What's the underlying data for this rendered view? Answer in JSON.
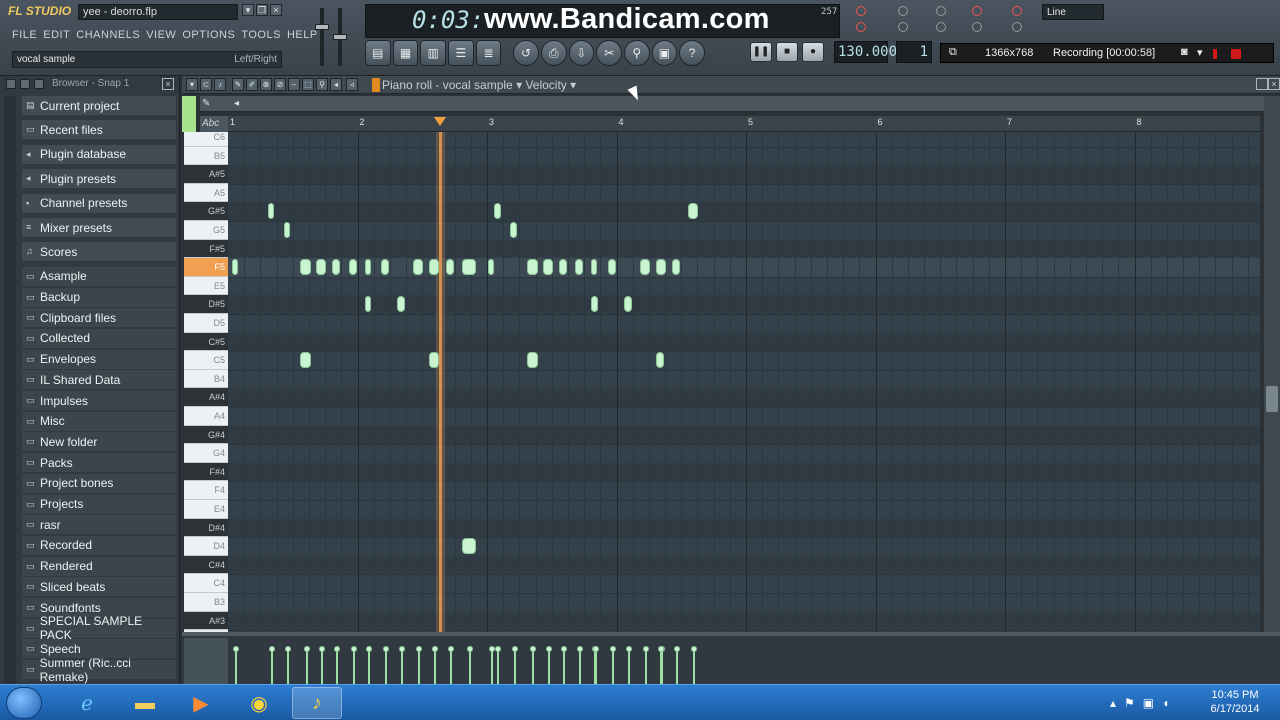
{
  "app": {
    "logo": "FL STUDIO",
    "file_title": "yee - deorro.flp",
    "menus": [
      "FILE",
      "EDIT",
      "CHANNELS",
      "VIEW",
      "OPTIONS",
      "TOOLS",
      "HELP"
    ],
    "hint_left": "vocal sample",
    "hint_right": "Left/Right",
    "time": "0:03:",
    "watermark": "www.Bandicam.com",
    "small_readout": "257",
    "bpm": "130.000",
    "pattern": "1",
    "snap": "Line"
  },
  "recording": {
    "resolution": "1366x768",
    "status": "Recording [00:00:58]"
  },
  "browser": {
    "title": "Browser - Snap 1",
    "items": [
      {
        "label": "Current project",
        "icon": "file-icon"
      },
      {
        "label": "Recent files",
        "icon": "folder-icon"
      },
      {
        "label": "Plugin database",
        "icon": "plug-icon"
      },
      {
        "label": "Plugin presets",
        "icon": "plug-icon"
      },
      {
        "label": "Channel presets",
        "icon": "channel-icon"
      },
      {
        "label": "Mixer presets",
        "icon": "mixer-icon"
      },
      {
        "label": "Scores",
        "icon": "note-icon"
      },
      {
        "label": "Asample",
        "icon": "folder-icon"
      },
      {
        "label": "Backup",
        "icon": "folder-icon"
      },
      {
        "label": "Clipboard files",
        "icon": "folder-icon"
      },
      {
        "label": "Collected",
        "icon": "folder-icon"
      },
      {
        "label": "Envelopes",
        "icon": "folder-icon"
      },
      {
        "label": "IL Shared Data",
        "icon": "folder-icon"
      },
      {
        "label": "Impulses",
        "icon": "folder-icon"
      },
      {
        "label": "Misc",
        "icon": "folder-icon"
      },
      {
        "label": "New folder",
        "icon": "folder-icon"
      },
      {
        "label": "Packs",
        "icon": "folder-icon"
      },
      {
        "label": "Project bones",
        "icon": "folder-icon"
      },
      {
        "label": "Projects",
        "icon": "folder-icon"
      },
      {
        "label": "rasr",
        "icon": "folder-icon"
      },
      {
        "label": "Recorded",
        "icon": "folder-icon"
      },
      {
        "label": "Rendered",
        "icon": "folder-icon"
      },
      {
        "label": "Sliced beats",
        "icon": "folder-icon"
      },
      {
        "label": "Soundfonts",
        "icon": "folder-icon"
      },
      {
        "label": "SPECIAL SAMPLE PACK",
        "icon": "folder-icon"
      },
      {
        "label": "Speech",
        "icon": "folder-icon"
      },
      {
        "label": "Summer (Ric..cci Remake)",
        "icon": "folder-icon"
      }
    ]
  },
  "piano_roll": {
    "title": "Piano roll - vocal sample",
    "target": "Velocity",
    "abc_label": "Abc",
    "ruler_bars": [
      "1",
      "2",
      "3",
      "4",
      "5",
      "6",
      "7",
      "8"
    ],
    "playhead_beat": 7.4,
    "active_key": "F5",
    "keys": [
      "C6",
      "B5",
      "A#5",
      "A5",
      "G#5",
      "G5",
      "F#5",
      "F5",
      "E5",
      "D#5",
      "D5",
      "C#5",
      "C5",
      "B4",
      "A#4",
      "A4",
      "G#4",
      "G4",
      "F#4",
      "F4",
      "E4",
      "D#4",
      "D4",
      "C#4",
      "C4",
      "B3",
      "A#3"
    ],
    "notes": [
      {
        "key": "F5",
        "start": 1.0,
        "len": 0.15
      },
      {
        "key": "G#5",
        "start": 2.1,
        "len": 0.2
      },
      {
        "key": "G5",
        "start": 2.6,
        "len": 0.2
      },
      {
        "key": "F5",
        "start": 3.1,
        "len": 0.35
      },
      {
        "key": "C5",
        "start": 3.1,
        "len": 0.35
      },
      {
        "key": "F5",
        "start": 3.6,
        "len": 0.3
      },
      {
        "key": "F5",
        "start": 4.1,
        "len": 0.25
      },
      {
        "key": "F5",
        "start": 4.6,
        "len": 0.25
      },
      {
        "key": "F5",
        "start": 5.1,
        "len": 0.15
      },
      {
        "key": "D#5",
        "start": 5.1,
        "len": 0.2
      },
      {
        "key": "F5",
        "start": 5.6,
        "len": 0.25
      },
      {
        "key": "D#5",
        "start": 6.1,
        "len": 0.25
      },
      {
        "key": "F5",
        "start": 6.6,
        "len": 0.3
      },
      {
        "key": "F5",
        "start": 7.1,
        "len": 0.3
      },
      {
        "key": "C5",
        "start": 7.1,
        "len": 0.3
      },
      {
        "key": "F5",
        "start": 7.6,
        "len": 0.25
      },
      {
        "key": "F5",
        "start": 8.1,
        "len": 0.45
      },
      {
        "key": "D4",
        "start": 8.1,
        "len": 0.45
      },
      {
        "key": "F5",
        "start": 8.9,
        "len": 0.15
      },
      {
        "key": "G#5",
        "start": 9.1,
        "len": 0.2
      },
      {
        "key": "G5",
        "start": 9.6,
        "len": 0.2
      },
      {
        "key": "F5",
        "start": 10.1,
        "len": 0.35
      },
      {
        "key": "C5",
        "start": 10.1,
        "len": 0.35
      },
      {
        "key": "F5",
        "start": 10.6,
        "len": 0.3
      },
      {
        "key": "F5",
        "start": 11.1,
        "len": 0.25
      },
      {
        "key": "F5",
        "start": 11.6,
        "len": 0.25
      },
      {
        "key": "F5",
        "start": 12.1,
        "len": 0.15
      },
      {
        "key": "D#5",
        "start": 12.1,
        "len": 0.2
      },
      {
        "key": "F5",
        "start": 12.6,
        "len": 0.25
      },
      {
        "key": "D#5",
        "start": 13.1,
        "len": 0.25
      },
      {
        "key": "F5",
        "start": 13.6,
        "len": 0.3
      },
      {
        "key": "F5",
        "start": 14.1,
        "len": 0.3
      },
      {
        "key": "C5",
        "start": 14.1,
        "len": 0.25
      },
      {
        "key": "F5",
        "start": 14.6,
        "len": 0.25
      },
      {
        "key": "G#5",
        "start": 15.1,
        "len": 0.3
      }
    ]
  },
  "taskbar": {
    "time": "10:45 PM",
    "date": "6/17/2014"
  }
}
